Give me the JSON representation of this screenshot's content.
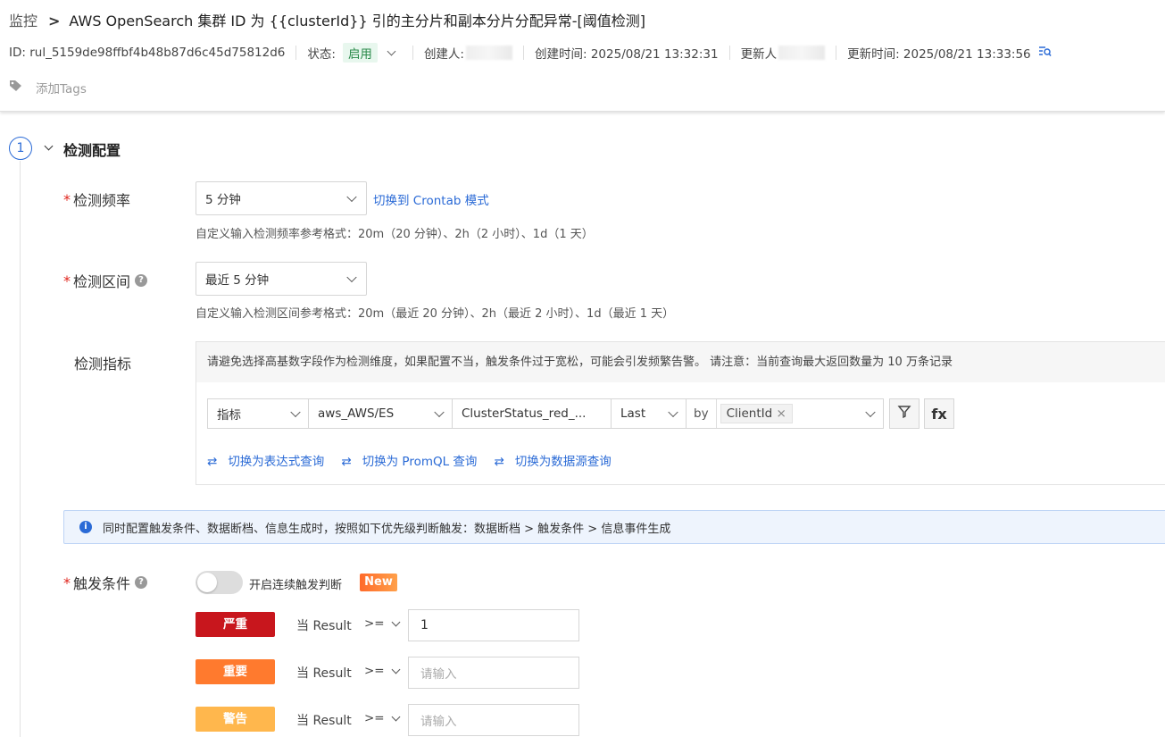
{
  "header": {
    "breadcrumb_root": "监控",
    "title": "AWS OpenSearch 集群 ID 为 {{clusterId}} 引的主分片和副本分片分配异常-[阈值检测]",
    "id_text": "ID: rul_5159de98ffbf4b48b87d6c45d75812d6",
    "status_label": "状态:",
    "status_value": "启用",
    "creator_label": "创建人:",
    "created_time": "创建时间: 2025/08/21 13:32:31",
    "updater_label": "更新人",
    "updated_time": "更新时间: 2025/08/21 13:33:56",
    "add_tags": "添加Tags"
  },
  "section": {
    "step": "1",
    "title": "检测配置"
  },
  "frequency": {
    "label": "检测频率",
    "value": "5 分钟",
    "switch_link": "切换到 Crontab 模式",
    "hint": "自定义输入检测频率参考格式：20m（20 分钟）、2h（2 小时）、1d（1 天）"
  },
  "interval": {
    "label": "检测区间",
    "value": "最近 5 分钟",
    "hint": "自定义输入检测区间参考格式：20m（最近 20 分钟）、2h（最近 2 小时）、1d（最近 1 天）"
  },
  "metric": {
    "label": "检测指标",
    "warning": "请避免选择高基数字段作为检测维度，如果配置不当，触发条件过于宽松，可能会引发频繁告警。 请注意：当前查询最大返回数量为 10 万条记录",
    "type": "指标",
    "namespace": "aws_AWS/ES",
    "field": "ClusterStatus_red_...",
    "agg": "Last",
    "by": "by",
    "group_tag": "ClientId",
    "fx": "fx",
    "links": [
      "切换为表达式查询",
      "切换为 PromQL 查询",
      "切换为数据源查询"
    ]
  },
  "info": "同时配置触发条件、数据断档、信息生成时，按照如下优先级判断触发：数据断档 > 触发条件 > 信息事件生成",
  "trigger": {
    "label": "触发条件",
    "toggle_label": "开启连续触发判断",
    "new_badge": "New",
    "rows": [
      {
        "level": "严重",
        "color": "#c8161d",
        "cond": "当 Result",
        "op": ">=",
        "value": "1",
        "placeholder": "请输入"
      },
      {
        "level": "重要",
        "color": "#ff7a2e",
        "cond": "当 Result",
        "op": ">=",
        "value": "",
        "placeholder": "请输入"
      },
      {
        "level": "警告",
        "color": "#ffb74d",
        "cond": "当 Result",
        "op": ">=",
        "value": "",
        "placeholder": "请输入"
      }
    ]
  },
  "colors": {
    "accent": "#2a6ad6",
    "required": "#e0261e"
  }
}
